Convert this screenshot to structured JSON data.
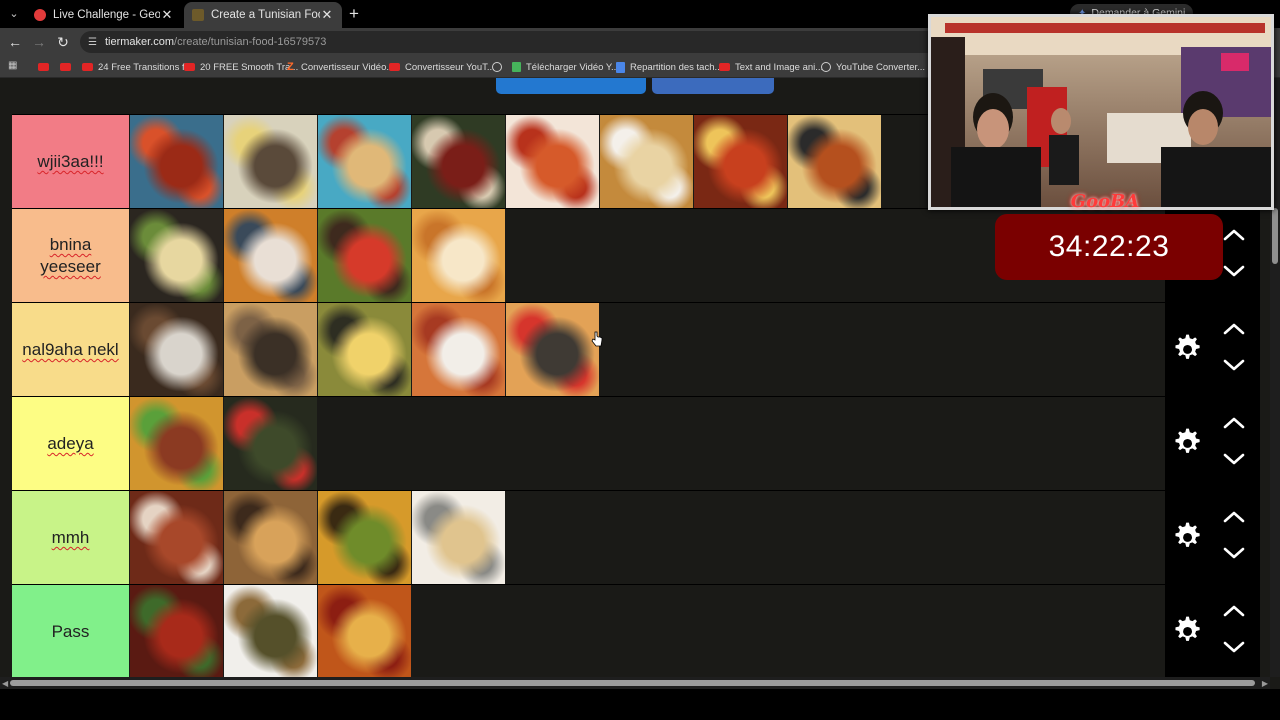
{
  "browser": {
    "tabs": [
      {
        "title": "Live Challenge - GeoGuessr",
        "active": false,
        "close": "✕"
      },
      {
        "title": "Create a Tunisian Food Tier List",
        "active": true,
        "close": "✕"
      }
    ],
    "new_tab": "+",
    "gemini_label": "Demander à Gemini",
    "url_host": "tiermaker.com",
    "url_path": "/create/tunisian-food-16579573",
    "bookmarks": [
      {
        "label": "",
        "icon": "youtube-icon"
      },
      {
        "label": "",
        "icon": "youtube-icon"
      },
      {
        "label": "24 Free Transitions f...",
        "icon": "youtube-icon"
      },
      {
        "label": "20 FREE Smooth Tra...",
        "icon": "youtube-icon"
      },
      {
        "label": "Convertisseur Vidéo...",
        "icon": "z-icon"
      },
      {
        "label": "Convertisseur YouT...",
        "icon": "youtube-icon"
      },
      {
        "label": "",
        "icon": "globe-icon"
      },
      {
        "label": "Télécharger Vidéo Y...",
        "icon": "download-icon"
      },
      {
        "label": "Repartition des tach...",
        "icon": "docs-icon"
      },
      {
        "label": "Text and Image ani...",
        "icon": "youtube-icon"
      },
      {
        "label": "YouTube Converter...",
        "icon": "globe-icon"
      }
    ]
  },
  "tiers": [
    {
      "label": "wjii3aa!!!",
      "color": "#f27c86",
      "spell": true,
      "items": [
        "spaghetti-dish",
        "beef-eggs-plate",
        "wrap-sandwich",
        "soup-bowl",
        "pizza",
        "crepe-plate",
        "shakshuka",
        "fries-pizza"
      ]
    },
    {
      "label": "bnina yeeseer",
      "color": "#f8bc8c",
      "spell": true,
      "items": [
        "pasta-skillet",
        "orange-soup",
        "grilled-salad",
        "brik-pastry"
      ]
    },
    {
      "label": "nal9aha nekl",
      "color": "#f8dc8a",
      "spell": true,
      "items": [
        "grilled-meat",
        "flatbread",
        "couscous-fries",
        "fricassee-rolls",
        "baguette-sandwich"
      ]
    },
    {
      "label": "adeya",
      "color": "#fdfd84",
      "spell": true,
      "items": [
        "couscous-platter",
        "mloukhia-stew"
      ]
    },
    {
      "label": "mmh",
      "color": "#c8f388",
      "spell": true,
      "items": [
        "meat-stew",
        "lamb-chickpeas",
        "veggie-couscous",
        "crepe"
      ]
    },
    {
      "label": "Pass",
      "color": "#81f08a",
      "spell": false,
      "items": [
        "tomato-stew",
        "green-stew",
        "potato-tagine"
      ]
    }
  ],
  "food_palettes": {
    "spaghetti-dish": [
      "#3a6e8c",
      "#9b2a16",
      "#d9512a"
    ],
    "beef-eggs-plate": [
      "#d8d2bc",
      "#5a4a3a",
      "#e7d27a"
    ],
    "wrap-sandwich": [
      "#48a9c4",
      "#e0b878",
      "#b5412f"
    ],
    "soup-bowl": [
      "#2f3b24",
      "#7a1e18",
      "#d7c9b0"
    ],
    "pizza": [
      "#f3e5d8",
      "#d65a2a",
      "#b8321c"
    ],
    "crepe-plate": [
      "#c48a3c",
      "#e9d3a3",
      "#f4f0ea"
    ],
    "shakshuka": [
      "#7a2814",
      "#c8401e",
      "#eec45a"
    ],
    "fries-pizza": [
      "#e3c07a",
      "#b5501e",
      "#2b2b2b"
    ],
    "pasta-skillet": [
      "#2b2620",
      "#e7d7a0",
      "#6b8c3a"
    ],
    "orange-soup": [
      "#cf7f2a",
      "#e9dfd5",
      "#3a4a5a"
    ],
    "grilled-salad": [
      "#5a7a2a",
      "#d63a2a",
      "#3e2a1e"
    ],
    "brik-pastry": [
      "#e8a64a",
      "#f7e7c8",
      "#c9752a"
    ],
    "grilled-meat": [
      "#3a2a1e",
      "#d9d4cc",
      "#6a4a32"
    ],
    "flatbread": [
      "#c99e62",
      "#3b3026",
      "#7d6246"
    ],
    "couscous-fries": [
      "#8a8a3a",
      "#f0d26a",
      "#2e2e22"
    ],
    "fricassee-rolls": [
      "#d6763a",
      "#f2eee8",
      "#a73a22"
    ],
    "baguette-sandwich": [
      "#e3a256",
      "#3f3a34",
      "#d6352c"
    ],
    "couscous-platter": [
      "#d1952e",
      "#8b3a22",
      "#5aa03a"
    ],
    "mloukhia-stew": [
      "#262a1e",
      "#3e4a2a",
      "#c9302a"
    ],
    "meat-stew": [
      "#6e2a18",
      "#a8482a",
      "#e5d3c3"
    ],
    "lamb-chickpeas": [
      "#8e6438",
      "#d8a25a",
      "#3d2a1c"
    ],
    "veggie-couscous": [
      "#d69a2a",
      "#6f8c2a",
      "#3a2a12"
    ],
    "crepe": [
      "#f2ede5",
      "#e0c48e",
      "#8a8a86"
    ],
    "tomato-stew": [
      "#5a1a12",
      "#a82a1a",
      "#3e6a2a"
    ],
    "green-stew": [
      "#f1efeb",
      "#55502a",
      "#8c6a3a"
    ],
    "potato-tagine": [
      "#c0561a",
      "#e7b04a",
      "#8c1e12"
    ]
  },
  "timer": "34:22:23",
  "stream_brand": "GooBA",
  "controls": {
    "gear_icon": "gear-icon",
    "up_icon": "chevron-up-icon",
    "down_icon": "chevron-down-icon"
  }
}
